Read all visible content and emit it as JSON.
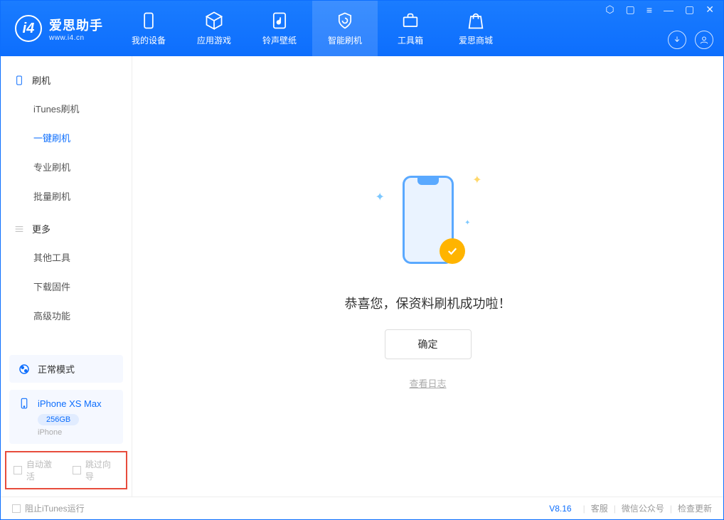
{
  "app": {
    "name": "爱思助手",
    "domain": "www.i4.cn"
  },
  "nav": {
    "my_device": "我的设备",
    "apps_games": "应用游戏",
    "ring_wall": "铃声壁纸",
    "smart_flash": "智能刷机",
    "toolbox": "工具箱",
    "store": "爱思商城"
  },
  "sidebar": {
    "flash_header": "刷机",
    "items_flash": {
      "itunes": "iTunes刷机",
      "onekey": "一键刷机",
      "pro": "专业刷机",
      "batch": "批量刷机"
    },
    "more_header": "更多",
    "items_more": {
      "other": "其他工具",
      "firmware": "下载固件",
      "advanced": "高级功能"
    }
  },
  "device_mode": {
    "label": "正常模式"
  },
  "device": {
    "name": "iPhone XS Max",
    "storage": "256GB",
    "type": "iPhone"
  },
  "options": {
    "auto_activate": "自动激活",
    "skip_wizard": "跳过向导"
  },
  "main": {
    "success_msg": "恭喜您，保资料刷机成功啦！",
    "ok_btn": "确定",
    "view_log": "查看日志"
  },
  "footer": {
    "block_itunes": "阻止iTunes运行",
    "version": "V8.16",
    "support": "客服",
    "wechat": "微信公众号",
    "update": "检查更新"
  }
}
